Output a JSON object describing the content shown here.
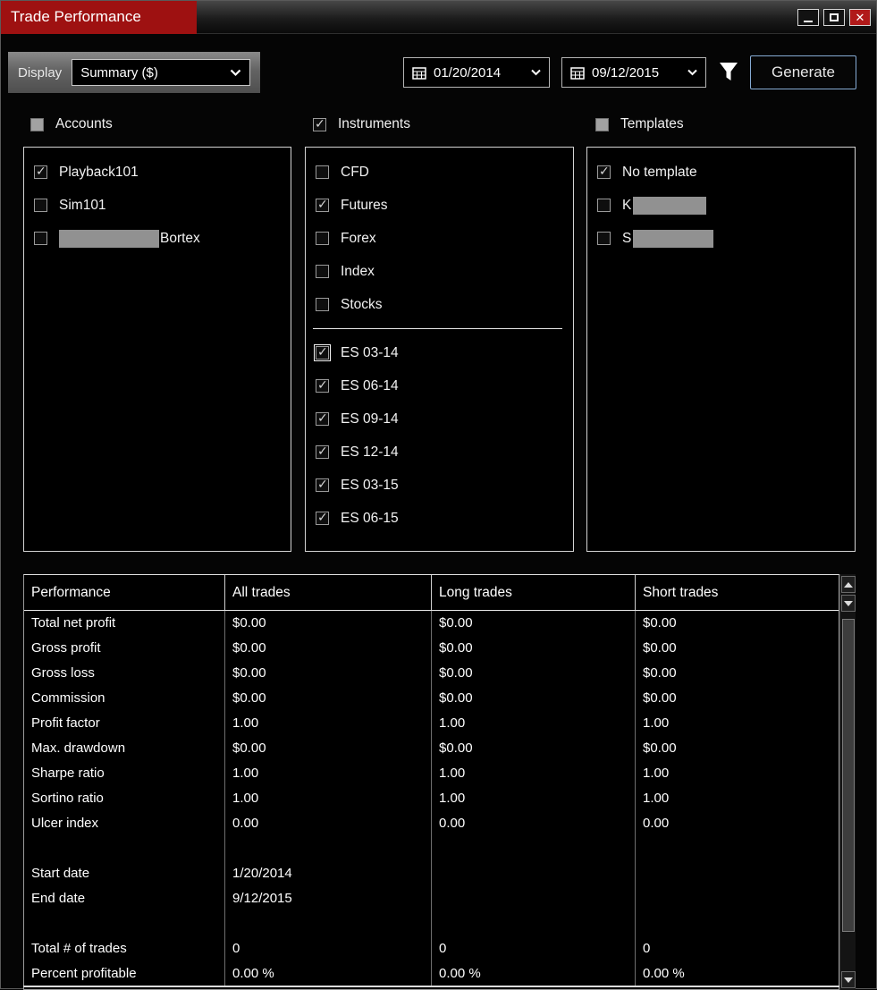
{
  "window": {
    "title": "Trade Performance"
  },
  "colors": {
    "title_tab_red": "#9e1111",
    "close_button_red": "#b11a1a",
    "generate_border_blue": "#86abd4",
    "panel_gray": "#6b6b6b",
    "redaction_gray": "#919191"
  },
  "icons": {
    "minimize": "minimize-icon",
    "maximize": "maximize-icon",
    "close": "close-icon",
    "calendar": "calendar-icon",
    "chevron_down": "chevron-down-icon",
    "filter_funnel": "filter-icon",
    "checkmark": "check-icon",
    "scroll_up_arrow": "scroll-up-icon",
    "scroll_down_arrow": "scroll-down-icon"
  },
  "toolbar": {
    "display_label": "Display",
    "display_value": "Summary ($)",
    "date_from": "01/20/2014",
    "date_to": "09/12/2015",
    "generate_label": "Generate"
  },
  "sections": {
    "accounts": {
      "label": "Accounts",
      "checkbox_state": "indeterminate",
      "items": [
        {
          "label": "Playback101",
          "checked": true
        },
        {
          "label": "Sim101",
          "checked": false
        },
        {
          "label": "Bortex",
          "checked": false,
          "redacted_prefix": true
        }
      ]
    },
    "instruments": {
      "label": "Instruments",
      "checkbox_state": "checked",
      "types": [
        {
          "label": "CFD",
          "checked": false
        },
        {
          "label": "Futures",
          "checked": true
        },
        {
          "label": "Forex",
          "checked": false
        },
        {
          "label": "Index",
          "checked": false
        },
        {
          "label": "Stocks",
          "checked": false
        }
      ],
      "contracts": [
        {
          "label": "ES 03-14",
          "checked": true,
          "focused": true
        },
        {
          "label": "ES 06-14",
          "checked": true
        },
        {
          "label": "ES 09-14",
          "checked": true
        },
        {
          "label": "ES 12-14",
          "checked": true
        },
        {
          "label": "ES 03-15",
          "checked": true
        },
        {
          "label": "ES 06-15",
          "checked": true
        }
      ]
    },
    "templates": {
      "label": "Templates",
      "checkbox_state": "indeterminate",
      "items": [
        {
          "label": "No template",
          "checked": true
        },
        {
          "label": "K",
          "checked": false,
          "redacted_suffix": true
        },
        {
          "label": "S",
          "checked": false,
          "redacted_suffix": true
        }
      ]
    }
  },
  "table": {
    "columns": [
      "Performance",
      "All trades",
      "Long trades",
      "Short trades"
    ],
    "rows": [
      {
        "label": "Total net profit",
        "all": "$0.00",
        "long": "$0.00",
        "short": "$0.00"
      },
      {
        "label": "Gross profit",
        "all": "$0.00",
        "long": "$0.00",
        "short": "$0.00"
      },
      {
        "label": "Gross loss",
        "all": "$0.00",
        "long": "$0.00",
        "short": "$0.00"
      },
      {
        "label": "Commission",
        "all": "$0.00",
        "long": "$0.00",
        "short": "$0.00"
      },
      {
        "label": "Profit factor",
        "all": "1.00",
        "long": "1.00",
        "short": "1.00"
      },
      {
        "label": "Max. drawdown",
        "all": "$0.00",
        "long": "$0.00",
        "short": "$0.00"
      },
      {
        "label": "Sharpe ratio",
        "all": "1.00",
        "long": "1.00",
        "short": "1.00"
      },
      {
        "label": "Sortino ratio",
        "all": "1.00",
        "long": "1.00",
        "short": "1.00"
      },
      {
        "label": "Ulcer index",
        "all": "0.00",
        "long": "0.00",
        "short": "0.00"
      },
      {
        "label": "",
        "all": "",
        "long": "",
        "short": ""
      },
      {
        "label": "Start date",
        "all": "1/20/2014",
        "long": "",
        "short": ""
      },
      {
        "label": "End date",
        "all": "9/12/2015",
        "long": "",
        "short": ""
      },
      {
        "label": "",
        "all": "",
        "long": "",
        "short": ""
      },
      {
        "label": "Total # of trades",
        "all": "0",
        "long": "0",
        "short": "0"
      },
      {
        "label": "Percent profitable",
        "all": "0.00 %",
        "long": "0.00 %",
        "short": "0.00 %"
      }
    ]
  }
}
